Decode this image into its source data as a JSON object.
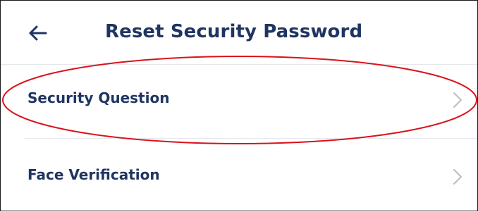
{
  "header": {
    "title": "Reset Security Password",
    "back_icon": "arrow-left-icon"
  },
  "menu": {
    "items": [
      {
        "label": "Security Question",
        "icon": "chevron-right-icon"
      },
      {
        "label": "Face Verification",
        "icon": "chevron-right-icon"
      }
    ]
  },
  "colors": {
    "title_text": "#1f3561",
    "label_text": "#1f3561",
    "chevron": "#b8bcc4",
    "divider": "#e6e8ec",
    "annotation": "#d9121b"
  }
}
